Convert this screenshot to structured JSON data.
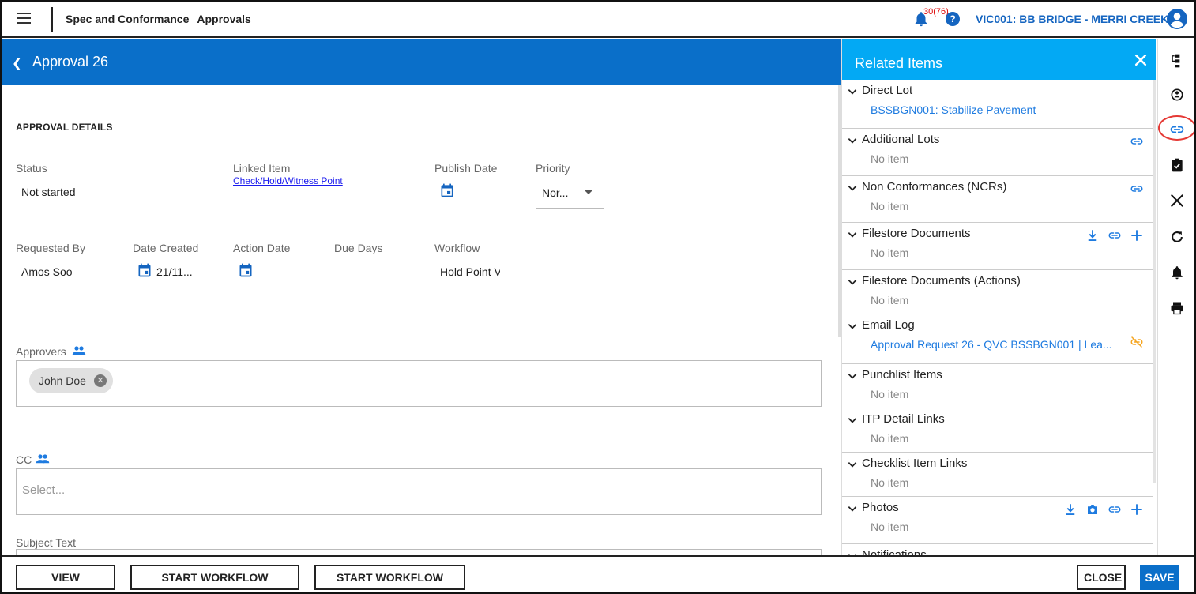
{
  "topbar": {
    "module": "Spec and Conformance",
    "page": "Approvals",
    "notification_count": "30(76)",
    "help_label": "?",
    "project": "VIC001: BB BRIDGE - MERRI CREEK"
  },
  "header": {
    "title": "Approval 26"
  },
  "form": {
    "section_title": "APPROVAL DETAILS",
    "status_label": "Status",
    "status_value": "Not started",
    "linked_item_label": "Linked Item",
    "linked_item_value": "Check/Hold/Witness Point",
    "publish_date_label": "Publish Date",
    "priority_label": "Priority",
    "priority_value": "Nor...",
    "requested_by_label": "Requested By",
    "requested_by_value": "Amos Soo",
    "date_created_label": "Date Created",
    "date_created_value": "21/11...",
    "action_date_label": "Action Date",
    "due_days_label": "Due Days",
    "workflow_label": "Workflow",
    "workflow_value": "Hold Point V",
    "approvers_label": "Approvers",
    "approvers": [
      "John Doe"
    ],
    "cc_label": "CC",
    "cc_placeholder": "Select...",
    "subject_label": "Subject Text"
  },
  "bottom": {
    "view_progress": "VIEW PROGRESS",
    "start_preview": "START WORKFLOW (PREVIEW)",
    "start_send": "START WORKFLOW (SEND)",
    "close": "CLOSE",
    "save": "SAVE"
  },
  "related": {
    "title": "Related Items",
    "sections": [
      {
        "label": "Direct Lot",
        "sub": "BSSBGN001: Stabilize Pavement",
        "sub_type": "link",
        "actions": []
      },
      {
        "label": "Additional Lots",
        "sub": "No item",
        "sub_type": "empty",
        "actions": [
          "link-icon"
        ]
      },
      {
        "label": "Non Conformances (NCRs)",
        "sub": "No item",
        "sub_type": "empty",
        "actions": [
          "link-icon"
        ]
      },
      {
        "label": "Filestore Documents",
        "sub": "No item",
        "sub_type": "empty",
        "actions": [
          "download-icon",
          "link-icon",
          "plus-icon"
        ]
      },
      {
        "label": "Filestore Documents (Actions)",
        "sub": "No item",
        "sub_type": "empty",
        "actions": []
      },
      {
        "label": "Email Log",
        "sub": "Approval Request 26 - QVC BSSBGN001 | Lea...",
        "sub_type": "link",
        "actions": [
          "unlink-icon"
        ]
      },
      {
        "label": "Punchlist Items",
        "sub": "No item",
        "sub_type": "empty",
        "actions": []
      },
      {
        "label": "ITP Detail Links",
        "sub": "No item",
        "sub_type": "empty",
        "actions": []
      },
      {
        "label": "Checklist Item Links",
        "sub": "No item",
        "sub_type": "empty",
        "actions": []
      },
      {
        "label": "Photos",
        "sub": "No item",
        "sub_type": "empty",
        "actions": [
          "download-icon",
          "camera-icon",
          "link-icon",
          "plus-icon"
        ]
      },
      {
        "label": "Notifications",
        "sub": "",
        "sub_type": "empty",
        "actions": []
      }
    ]
  },
  "rail": {
    "icons": [
      "workflow-icon",
      "person-badge-icon",
      "link-icon",
      "clipboard-check-icon",
      "close-icon",
      "refresh-icon",
      "bell-icon",
      "print-icon"
    ]
  },
  "colors": {
    "primary": "#0a6fc9",
    "panel_header": "#03a9f4",
    "link": "#1e7be0",
    "highlight": "#e53935",
    "warning_icon": "#f5a623"
  }
}
